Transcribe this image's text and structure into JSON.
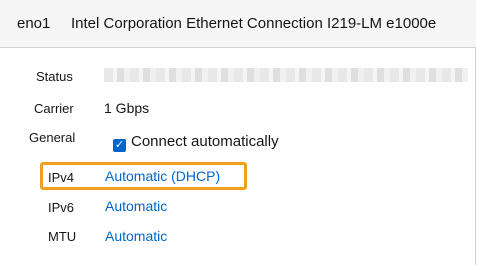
{
  "header": {
    "interface_name": "eno1",
    "interface_description": "Intel Corporation Ethernet Connection I219-LM e1000e"
  },
  "rows": {
    "status": {
      "label": "Status",
      "value": ""
    },
    "carrier": {
      "label": "Carrier",
      "value": "1 Gbps"
    },
    "general": {
      "label": "General",
      "checkbox_label": "Connect automatically",
      "checked": true
    },
    "ipv4": {
      "label": "IPv4",
      "value": "Automatic (DHCP)"
    },
    "ipv6": {
      "label": "IPv6",
      "value": "Automatic"
    },
    "mtu": {
      "label": "MTU",
      "value": "Automatic"
    }
  },
  "colors": {
    "link": "#0066cc",
    "highlight": "#f0a020",
    "header_bg": "#f5f5f5"
  },
  "icons": {
    "checkbox": "checkmark-icon"
  }
}
